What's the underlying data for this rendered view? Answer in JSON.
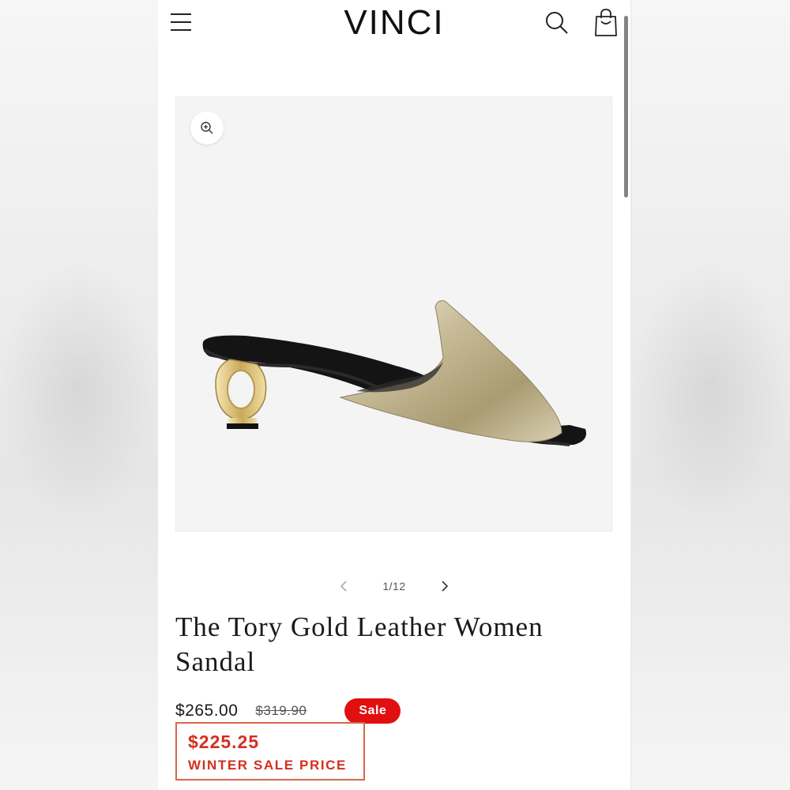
{
  "header": {
    "brand": "VINCI",
    "menu_icon": "hamburger-menu-icon",
    "search_icon": "search-icon",
    "cart_icon": "shopping-bag-icon"
  },
  "gallery": {
    "zoom_icon": "zoom-in-icon",
    "counter": "1/12",
    "prev_icon": "chevron-left-icon",
    "next_icon": "chevron-right-icon"
  },
  "product": {
    "title": "The Tory Gold Leather Women Sandal",
    "price": "$265.00",
    "compare_at_price": "$319.90",
    "badge": "Sale",
    "winter_price": "$225.25",
    "winter_label": "WINTER SALE PRICE"
  },
  "colors": {
    "sale_badge": "#e01010",
    "promo_text": "#d52e1f",
    "promo_border": "#d9664a"
  }
}
